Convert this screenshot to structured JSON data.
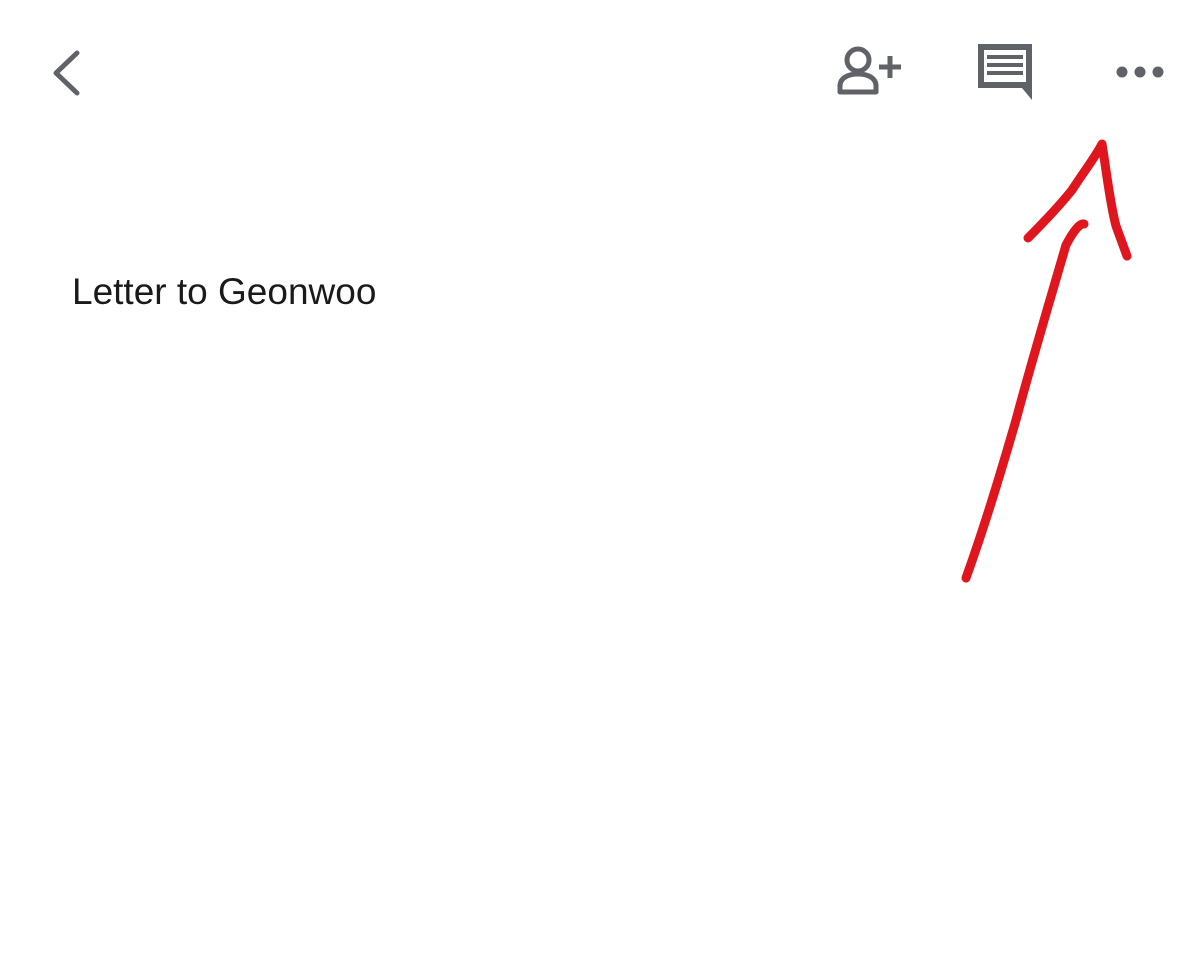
{
  "toolbar": {
    "back_icon": "chevron-left-icon",
    "share_icon": "person-add-icon",
    "comments_icon": "comment-icon",
    "more_icon": "more-horizontal-icon",
    "icon_color": "#5f6368"
  },
  "document": {
    "title": "Letter to Geonwoo"
  },
  "annotation": {
    "type": "hand-drawn-arrow",
    "color": "#e0161f",
    "points_to": "more-options-button"
  }
}
